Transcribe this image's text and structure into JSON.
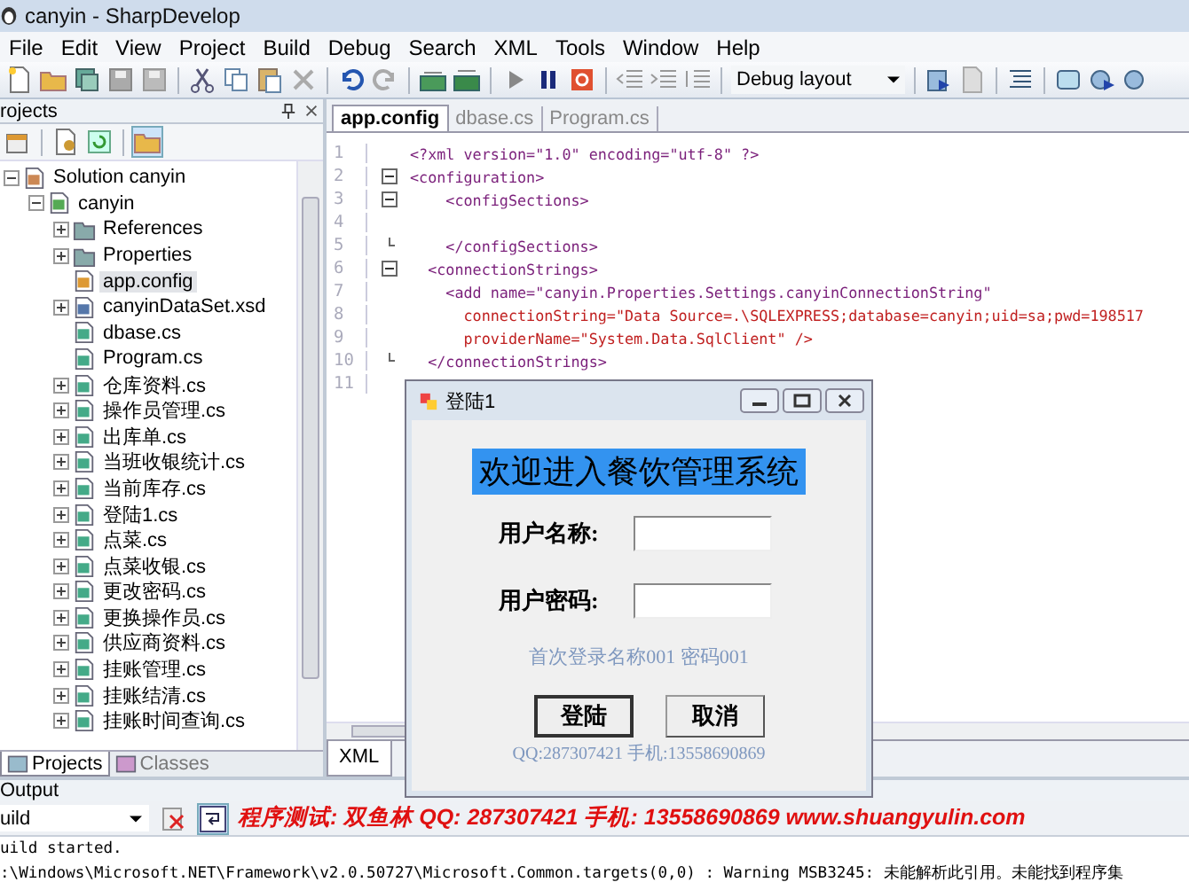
{
  "window": {
    "title": "canyin - SharpDevelop"
  },
  "menu": [
    "File",
    "Edit",
    "View",
    "Project",
    "Build",
    "Debug",
    "Search",
    "XML",
    "Tools",
    "Window",
    "Help"
  ],
  "toolbar": {
    "layout": "Debug layout"
  },
  "projects": {
    "title": "rojects",
    "tree": [
      {
        "label": "Solution canyin",
        "kind": "solution",
        "expanded": true,
        "selected": false,
        "children": [
          {
            "label": "canyin",
            "kind": "project",
            "expanded": true,
            "selected": false,
            "children": [
              {
                "label": "References",
                "kind": "folder",
                "expanded": false,
                "selected": false
              },
              {
                "label": "Properties",
                "kind": "folder",
                "expanded": false,
                "selected": false
              },
              {
                "label": "app.config",
                "kind": "config",
                "selected": true
              },
              {
                "label": "canyinDataSet.xsd",
                "kind": "xsd",
                "expanded": false,
                "selected": false
              },
              {
                "label": "dbase.cs",
                "kind": "cs",
                "selected": false
              },
              {
                "label": "Program.cs",
                "kind": "cs",
                "selected": false
              },
              {
                "label": "仓库资料.cs",
                "kind": "cs",
                "expanded": false,
                "selected": false
              },
              {
                "label": "操作员管理.cs",
                "kind": "cs",
                "expanded": false,
                "selected": false
              },
              {
                "label": "出库单.cs",
                "kind": "cs",
                "expanded": false,
                "selected": false
              },
              {
                "label": "当班收银统计.cs",
                "kind": "cs",
                "expanded": false,
                "selected": false
              },
              {
                "label": "当前库存.cs",
                "kind": "cs",
                "expanded": false,
                "selected": false
              },
              {
                "label": "登陆1.cs",
                "kind": "cs",
                "expanded": false,
                "selected": false
              },
              {
                "label": "点菜.cs",
                "kind": "cs",
                "expanded": false,
                "selected": false
              },
              {
                "label": "点菜收银.cs",
                "kind": "cs",
                "expanded": false,
                "selected": false
              },
              {
                "label": "更改密码.cs",
                "kind": "cs",
                "expanded": false,
                "selected": false
              },
              {
                "label": "更换操作员.cs",
                "kind": "cs",
                "expanded": false,
                "selected": false
              },
              {
                "label": "供应商资料.cs",
                "kind": "cs",
                "expanded": false,
                "selected": false
              },
              {
                "label": "挂账管理.cs",
                "kind": "cs",
                "expanded": false,
                "selected": false
              },
              {
                "label": "挂账结清.cs",
                "kind": "cs",
                "expanded": false,
                "selected": false
              },
              {
                "label": "挂账时间查询.cs",
                "kind": "cs",
                "expanded": false,
                "selected": false
              }
            ]
          }
        ]
      }
    ],
    "tabs": [
      {
        "label": "Projects",
        "selected": true
      },
      {
        "label": "Classes",
        "selected": false
      }
    ]
  },
  "editor": {
    "tabs": [
      {
        "label": "app.config",
        "selected": true
      },
      {
        "label": "dbase.cs",
        "selected": false
      },
      {
        "label": "Program.cs",
        "selected": false
      }
    ],
    "lines": [
      {
        "number": "1",
        "text": "<?xml version=\"1.0\" encoding=\"utf-8\" ?>",
        "kind": "plain",
        "color": "#7a1f7a"
      },
      {
        "number": "2",
        "text": "<configuration>",
        "kind": "fold",
        "color": "#7a1f7a"
      },
      {
        "number": "3",
        "text": "    <configSections>",
        "kind": "fold",
        "color": "#7a1f7a"
      },
      {
        "number": "4",
        "kind": "plain"
      },
      {
        "number": "5",
        "text": "    </configSections>",
        "kind": "fold-end",
        "color": "#7a1f7a"
      },
      {
        "number": "6",
        "text": "  <connectionStrings>",
        "kind": "fold",
        "color": "#7a1f7a"
      },
      {
        "number": "7",
        "text": "    <add name=\"canyin.Properties.Settings.canyinConnectionString\"",
        "kind": "plain",
        "color": "#7a1f7a"
      },
      {
        "number": "8",
        "text": "      connectionString=\"Data Source=.\\SQLEXPRESS;database=canyin;uid=sa;pwd=198517",
        "kind": "plain",
        "color": "#c02020"
      },
      {
        "number": "9",
        "text": "      providerName=\"System.Data.SqlClient\" />",
        "kind": "plain",
        "color": "#c02020"
      },
      {
        "number": "10",
        "text": "  </connectionStrings>",
        "kind": "fold-end",
        "color": "#7a1f7a"
      },
      {
        "number": "11",
        "kind": "plain"
      }
    ],
    "bottom_tab": "XML"
  },
  "dialog": {
    "title": "登陆1",
    "heading": "欢迎进入餐饮管理系统",
    "fields": [
      {
        "label": "用户名称:"
      },
      {
        "label": "用户密码:"
      }
    ],
    "hint": "首次登录名称001 密码001",
    "buttons": [
      {
        "label": "登陆",
        "selected": true
      },
      {
        "label": "取消",
        "selected": false
      }
    ],
    "contact": "QQ:287307421 手机:13558690869"
  },
  "output": {
    "title": "Output",
    "source": "uild",
    "banner": "程序测试: 双鱼林   QQ: 287307421   手机: 13558690869   www.shuangyulin.com",
    "lines": [
      "uild started.",
      ":\\Windows\\Microsoft.NET\\Framework\\v2.0.50727\\Microsoft.Common.targets(0,0) : Warning MSB3245: 未能解析此引用。未能找到程序集"
    ]
  }
}
